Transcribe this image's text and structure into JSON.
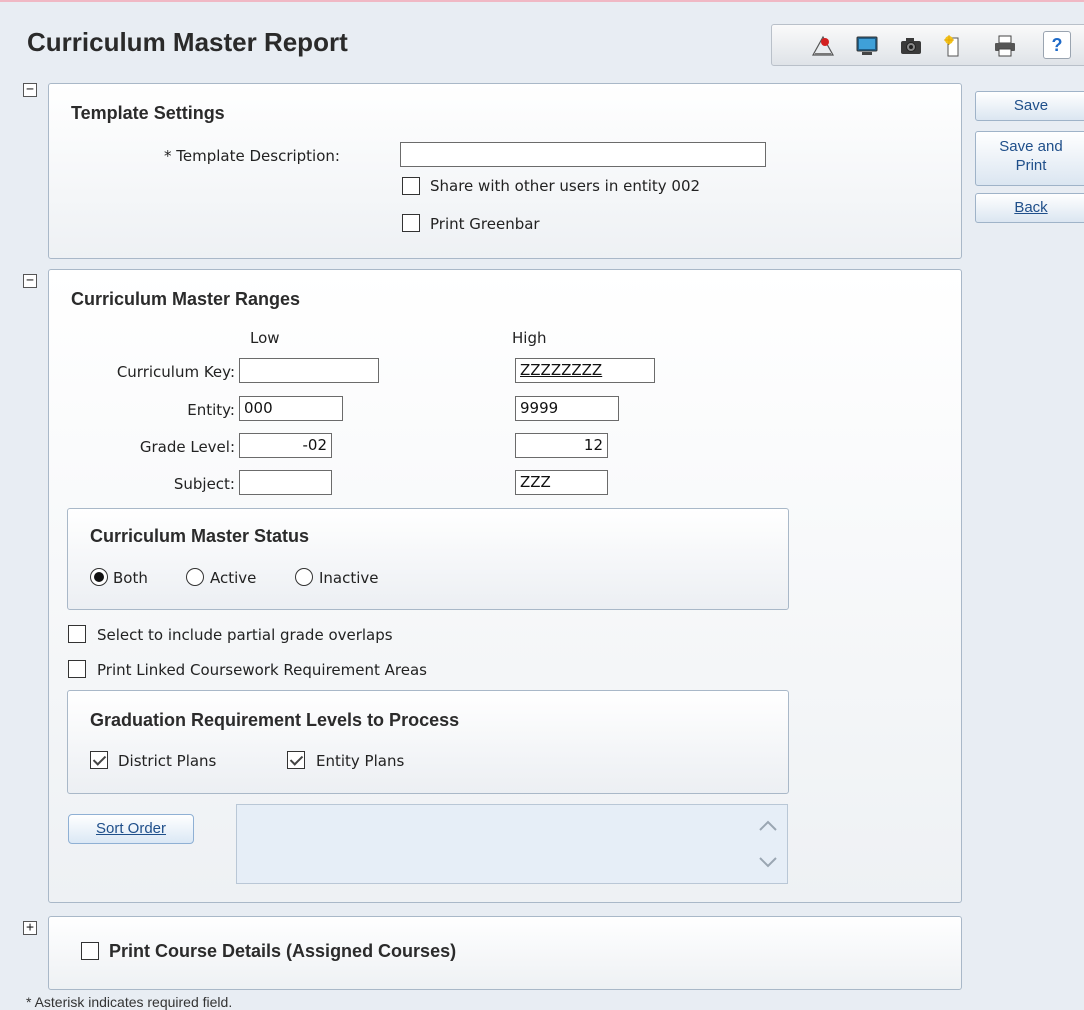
{
  "header": {
    "title": "Curriculum Master Report",
    "help_label": "?"
  },
  "toolbar_icons": [
    "report-viewer-icon",
    "monitor-icon",
    "camera-icon",
    "new-document-icon",
    "printer-icon",
    "help-icon"
  ],
  "sidebar_buttons": {
    "save": "Save",
    "save_print_line1": "Save and",
    "save_print_line2": "Print",
    "back": "Back"
  },
  "template_settings": {
    "toggle": "−",
    "title": "Template Settings",
    "description_label": "* Template Description:",
    "description_value": "",
    "share_label": "Share with other users in entity 002",
    "share_checked": false,
    "greenbar_label": "Print Greenbar",
    "greenbar_checked": false
  },
  "ranges": {
    "toggle": "−",
    "title": "Curriculum Master Ranges",
    "low_header": "Low",
    "high_header": "High",
    "rows": [
      {
        "label": "Curriculum Key:",
        "low": "",
        "high": "ZZZZZZZZ"
      },
      {
        "label": "Entity:",
        "low": "000",
        "high": "9999"
      },
      {
        "label": "Grade Level:",
        "low": "-02",
        "high": "12"
      },
      {
        "label": "Subject:",
        "low": "",
        "high": "ZZZ"
      }
    ],
    "status": {
      "title": "Curriculum Master Status",
      "options": [
        "Both",
        "Active",
        "Inactive"
      ],
      "selected": "Both"
    },
    "partial_overlap_label": "Select to include partial grade overlaps",
    "partial_overlap_checked": false,
    "linked_areas_label": "Print Linked Coursework Requirement Areas",
    "linked_areas_checked": false,
    "graduation": {
      "title": "Graduation Requirement Levels to Process",
      "district_label": "District Plans",
      "district_checked": true,
      "entity_label": "Entity Plans",
      "entity_checked": true
    },
    "sort_order_label": "Sort Order"
  },
  "course_details": {
    "toggle": "+",
    "label": "Print Course Details (Assigned Courses)",
    "checked": false
  },
  "footnote": "* Asterisk indicates required field."
}
